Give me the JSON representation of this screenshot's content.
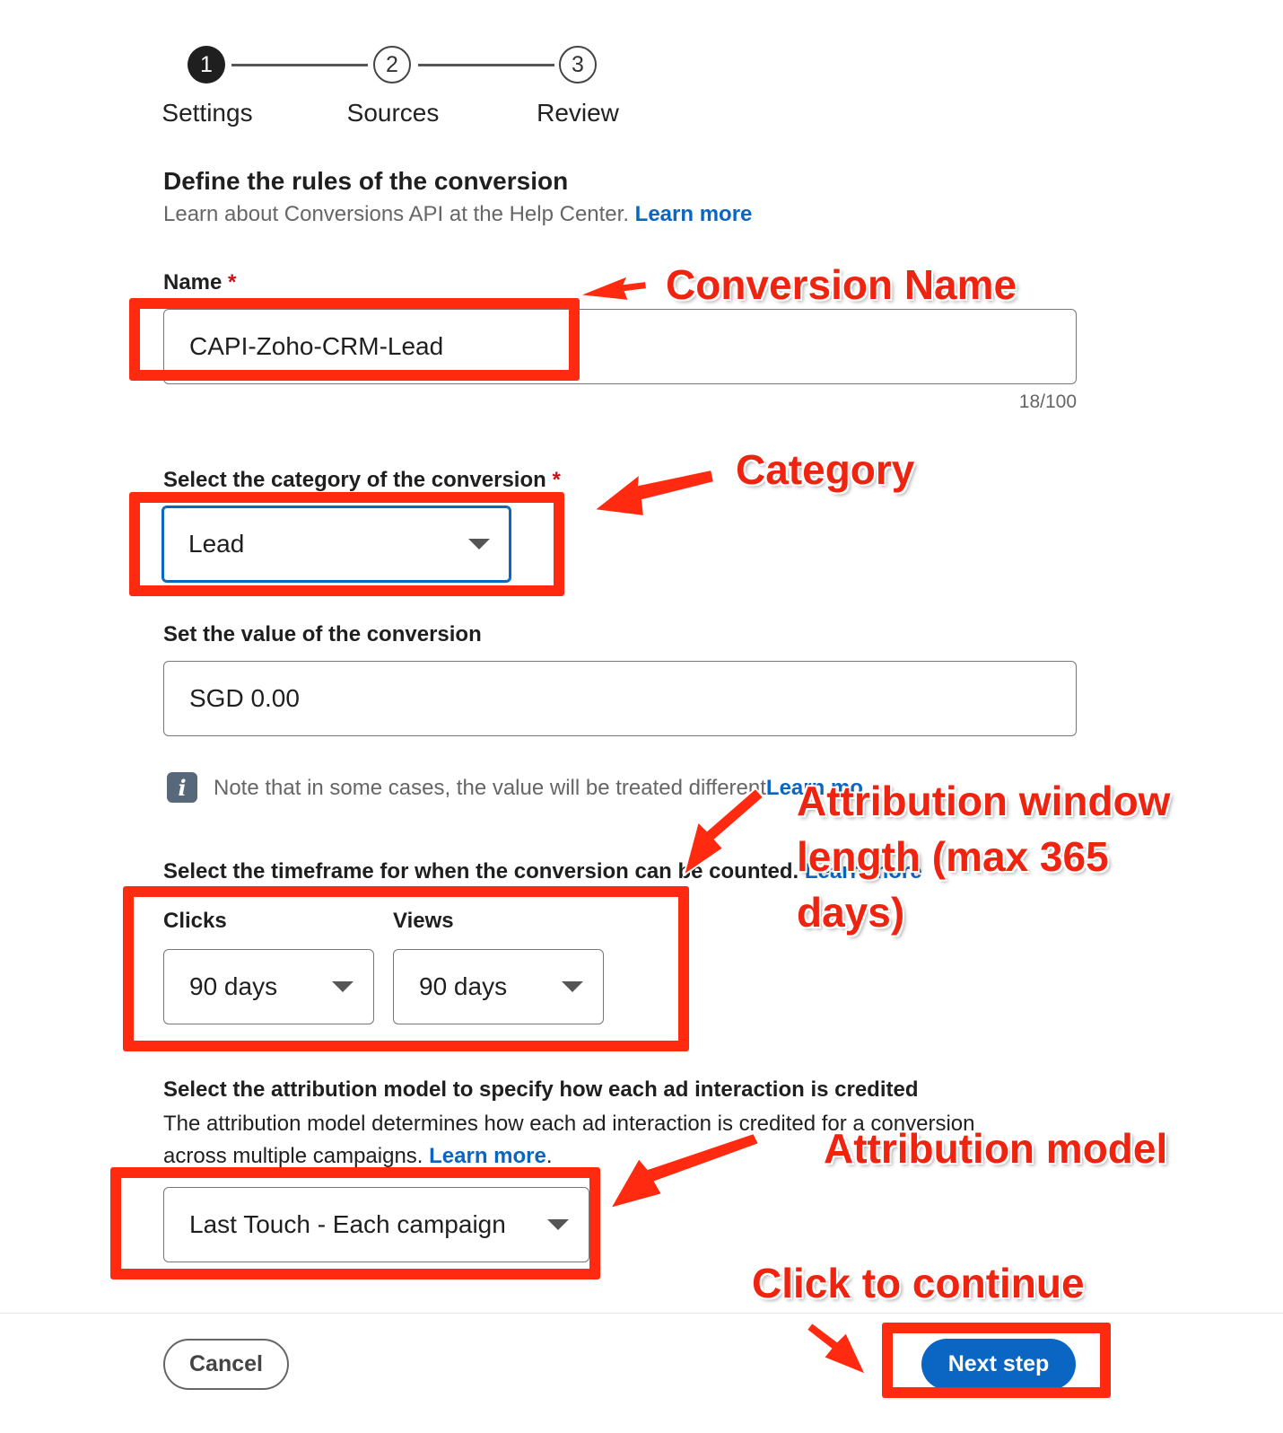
{
  "stepper": {
    "steps": [
      {
        "number": "1",
        "label": "Settings",
        "state": "active"
      },
      {
        "number": "2",
        "label": "Sources",
        "state": "todo"
      },
      {
        "number": "3",
        "label": "Review",
        "state": "todo"
      }
    ]
  },
  "header": {
    "title": "Define the rules of the conversion",
    "subtitle": "Learn about Conversions API at the Help Center.",
    "learn_more": "Learn more"
  },
  "name_field": {
    "label": "Name",
    "required_mark": "*",
    "value": "CAPI-Zoho-CRM-Lead",
    "counter": "18/100"
  },
  "category_field": {
    "label": "Select the category of the conversion",
    "required_mark": "*",
    "value": "Lead"
  },
  "value_field": {
    "label": "Set the value of the conversion",
    "value": "SGD 0.00"
  },
  "note": {
    "text": "Note that in some cases, the value will be treated different",
    "link": "Learn mo"
  },
  "timeframe": {
    "label": "Select the timeframe for when the conversion can be counted.",
    "link": "Learn more",
    "clicks_label": "Clicks",
    "clicks_value": "90 days",
    "views_label": "Views",
    "views_value": "90 days"
  },
  "attribution": {
    "label": "Select the attribution model to specify how each ad interaction is credited",
    "description_line1": "The attribution model determines how each ad interaction is credited for a conversion",
    "description_line2": "across multiple campaigns.",
    "learn_more": "Learn more",
    "period": ".",
    "value": "Last Touch - Each campaign"
  },
  "footer": {
    "cancel_label": "Cancel",
    "next_label": "Next step"
  },
  "annotations": {
    "conversion_name": "Conversion Name",
    "category": "Category",
    "attribution_window_line1": "Attribution window",
    "attribution_window_line2": "length (max 365",
    "attribution_window_line3": "days)",
    "attribution_model": "Attribution model",
    "click_to_continue": "Click to continue"
  },
  "colors": {
    "accent": "#0a66c2",
    "annotation": "#ff2a10",
    "required": "#cc1016"
  }
}
